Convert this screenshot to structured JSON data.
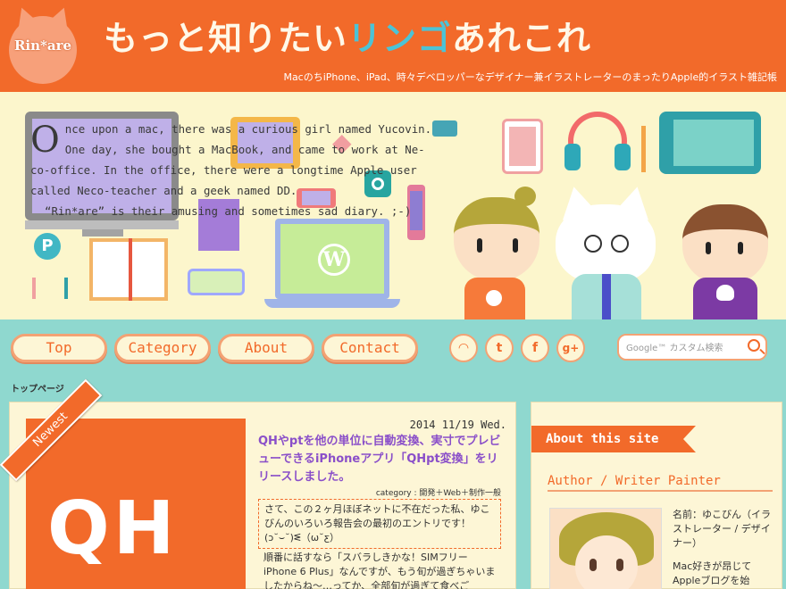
{
  "header": {
    "logo_text": "Rin*are",
    "title_part1": "もっと知りたい",
    "title_accent": "リンゴ",
    "title_part2": "あれこれ",
    "tagline": "MacのちiPhone、iPad、時々デベロッパーなデザイナー兼イラストレーターのまったりApple的イラスト雑記帳"
  },
  "hero": {
    "story_cap": "O",
    "story_line1": "nce upon a mac, there was a curious girl named Yucovin.",
    "story_line2": "One day, she bought a MacBook, and came to work at Ne-",
    "story_line3": "co-office. In the office, there were a longtime Apple user",
    "story_line4": "called Neco-teacher and a geek named DD.",
    "story_line5": "“Rin*are” is their amusing and sometimes sad diary. ;-)",
    "pinterest_glyph": "P",
    "wordpress_glyph": "W"
  },
  "nav": {
    "items": [
      {
        "label": "Top"
      },
      {
        "label": "Category"
      },
      {
        "label": "About"
      },
      {
        "label": "Contact"
      }
    ],
    "social": [
      {
        "icon": "rss-icon",
        "glyph": "◠"
      },
      {
        "icon": "twitter-icon",
        "glyph": "t"
      },
      {
        "icon": "facebook-icon",
        "glyph": "f"
      },
      {
        "icon": "googleplus-icon",
        "glyph": "g+"
      }
    ],
    "search_placeholder": "Google™ カスタム検索"
  },
  "breadcrumb": "トップページ",
  "post": {
    "ribbon": "Newest",
    "thumbnail_text": "QH",
    "date": "2014 11/19 Wed.",
    "title": "QHやptを他の単位に自動変換、実寸でプレビューできるiPhoneアプリ「QHpt変換」をリリースしました。",
    "category": "category : 開発＋Web＋制作一般",
    "excerpt1": "さて、この２ヶ月ほぼネットに不在だった私、ゆこびんのいろいろ報告会の最初のエントリです！(ɔ˘⌣˘)ᓬ（ω˘ƹ）",
    "excerpt2": "順番に話すなら「スバラしきかな！SIMフリーiPhone 6 Plus」なんですが、もう旬が過ぎちゃいましたからね〜…ってか、全部旬が過ぎて食べご"
  },
  "sidebar": {
    "heading": "About this site",
    "subheading": "Author / Writer Painter",
    "author_name": "名前：ゆこびん（イラストレーター / デザイナー）",
    "author_bio": "Mac好きが昂じてAppleブログを始"
  },
  "colors": {
    "orange": "#f26a2a",
    "teal": "#8fd8cf",
    "cream": "#fdf6d6",
    "hero_bg": "#fcf6cc",
    "purple_link": "#8a4fc9"
  }
}
